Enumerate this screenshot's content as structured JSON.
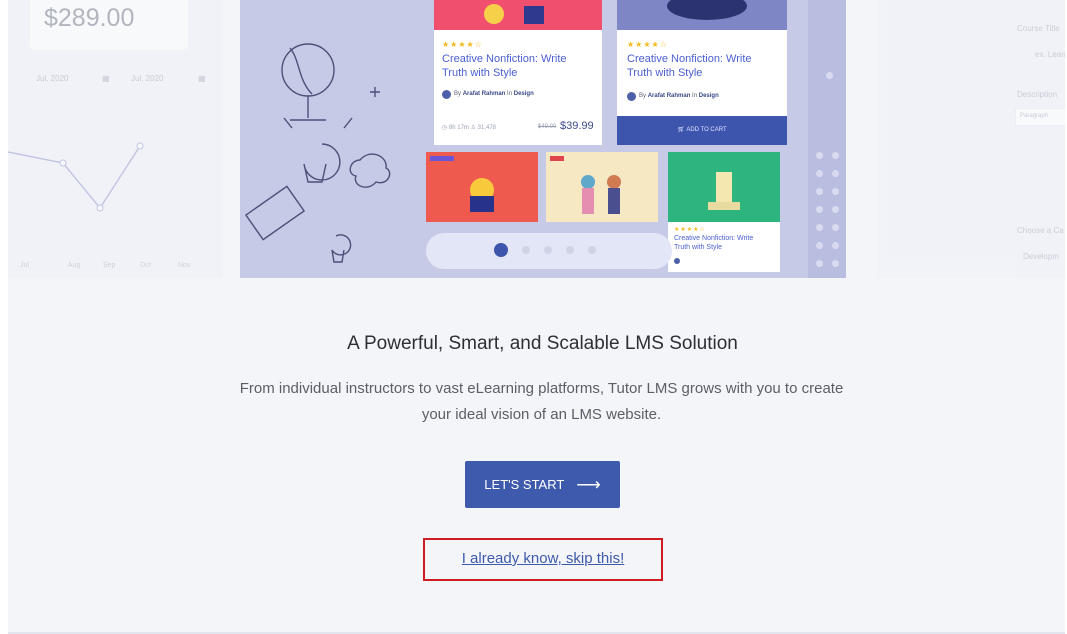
{
  "background_preview": {
    "left_panel": {
      "price": "$289.00",
      "date_from": "Jul, 2020",
      "date_to": "Jul, 2020",
      "months": [
        "Jul",
        "Aug",
        "Sep",
        "Oct",
        "Nov"
      ]
    },
    "course_cards": [
      {
        "title_line1": "Creative Nonfiction: Write",
        "title_line2": "Truth with Style",
        "author_prefix": "By",
        "author": "Arafat Rahman",
        "category_prefix": "In",
        "category": "Design",
        "lessons": "8h 17m",
        "students": "31,478",
        "old_price": "$49.00",
        "price": "$39.99"
      },
      {
        "title_line1": "Creative Nonfiction: Write",
        "title_line2": "Truth with Style",
        "author_prefix": "By",
        "author": "Arafat Rahman",
        "category_prefix": "In",
        "category": "Design",
        "cart_label": "ADD TO CART"
      },
      {
        "title_line1": "Creative Nonfiction: Write",
        "title_line2": "Truth with Style"
      }
    ],
    "right_panel": {
      "course_title_label": "Course Title",
      "course_title_placeholder": "ex. Learn",
      "description_label": "Description",
      "editor_mode": "Paragraph",
      "category_label": "Choose a Ca",
      "category_value": "Developm"
    }
  },
  "main": {
    "heading": "A Powerful, Smart, and Scalable LMS Solution",
    "description": "From individual instructors to vast eLearning platforms, Tutor LMS grows with you to create your ideal vision of an LMS website.",
    "start_button_label": "LET'S START",
    "start_button_arrow": "⟶",
    "skip_link_label": "I already know, skip this!"
  },
  "colors": {
    "primary": "#3e5aad",
    "highlight_border": "#cf1c22",
    "star": "#f3b81b"
  }
}
